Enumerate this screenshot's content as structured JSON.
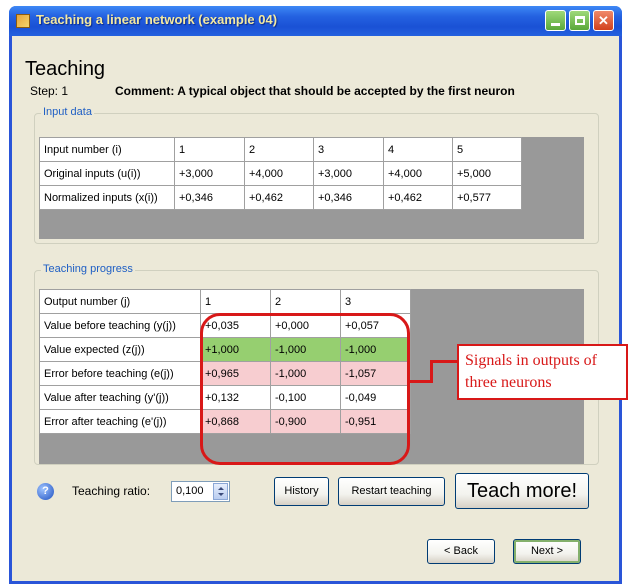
{
  "window": {
    "title": "Teaching a linear network (example 04)",
    "controls": {
      "minimize": "",
      "maximize": "",
      "close": "✕"
    }
  },
  "header": {
    "heading": "Teaching",
    "step": "Step: 1",
    "comment": "Comment: A typical object that should be accepted by the first neuron"
  },
  "input_data": {
    "legend": "Input data",
    "rows": [
      {
        "label": "Input number (i)",
        "values": [
          "1",
          "2",
          "3",
          "4",
          "5"
        ]
      },
      {
        "label": "Original inputs (u(i))",
        "values": [
          "+3,000",
          "+4,000",
          "+3,000",
          "+4,000",
          "+5,000"
        ]
      },
      {
        "label": "Normalized inputs (x(i))",
        "values": [
          "+0,346",
          "+0,462",
          "+0,346",
          "+0,462",
          "+0,577"
        ]
      }
    ]
  },
  "teaching_progress": {
    "legend": "Teaching progress",
    "rows": [
      {
        "label": "Output number (j)",
        "values": [
          "1",
          "2",
          "3"
        ],
        "style": ""
      },
      {
        "label": "Value before teaching (y(j))",
        "values": [
          "+0,035",
          "+0,000",
          "+0,057"
        ],
        "style": ""
      },
      {
        "label": "Value expected (z(j))",
        "values": [
          "+1,000",
          "-1,000",
          "-1,000"
        ],
        "style": "green"
      },
      {
        "label": "Error before teaching (e(j))",
        "values": [
          "+0,965",
          "-1,000",
          "-1,057"
        ],
        "style": "pink"
      },
      {
        "label": "Value after teaching (y'(j))",
        "values": [
          "+0,132",
          "-0,100",
          "-0,049"
        ],
        "style": ""
      },
      {
        "label": "Error after teaching (e'(j))",
        "values": [
          "+0,868",
          "-0,900",
          "-0,951"
        ],
        "style": "pink"
      }
    ]
  },
  "annotation": {
    "callout": "Signals in outputs of three neurons",
    "color": "#d81818"
  },
  "controls": {
    "info_icon": "?",
    "ratio_label": "Teaching ratio:",
    "ratio_value": "0,100",
    "history": "History",
    "restart": "Restart teaching",
    "teach_more": "Teach more!",
    "back": "< Back",
    "next": "Next >"
  },
  "colors": {
    "titlebar": "#2461e0",
    "green_cell": "#96cf70",
    "pink_cell": "#f7cdd0",
    "legend_text": "#1f5fc4"
  }
}
